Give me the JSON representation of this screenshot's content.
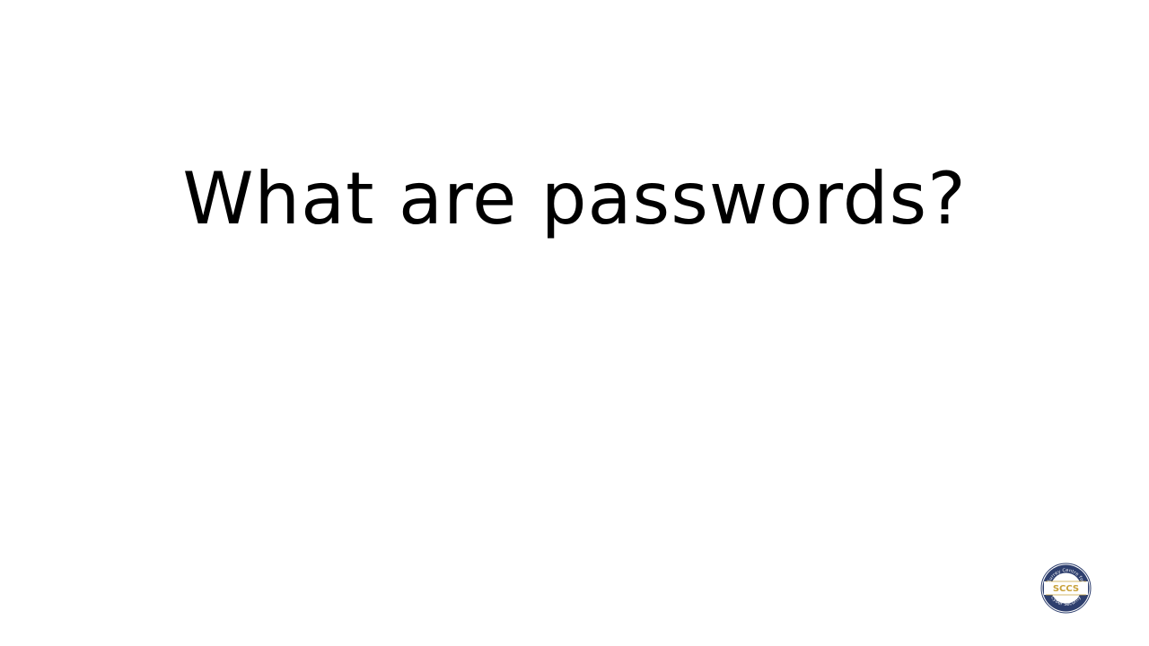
{
  "slide": {
    "title": "What are passwords?"
  },
  "logo": {
    "icon": "sccs-seal-icon",
    "center_text": "SCCS",
    "ring_text_top": "Surrey Centre for",
    "ring_text_bottom": "Cyber Security",
    "colors": {
      "ring": "#2e3f6e",
      "band": "#ffffff",
      "accent": "#c9a23a"
    }
  }
}
